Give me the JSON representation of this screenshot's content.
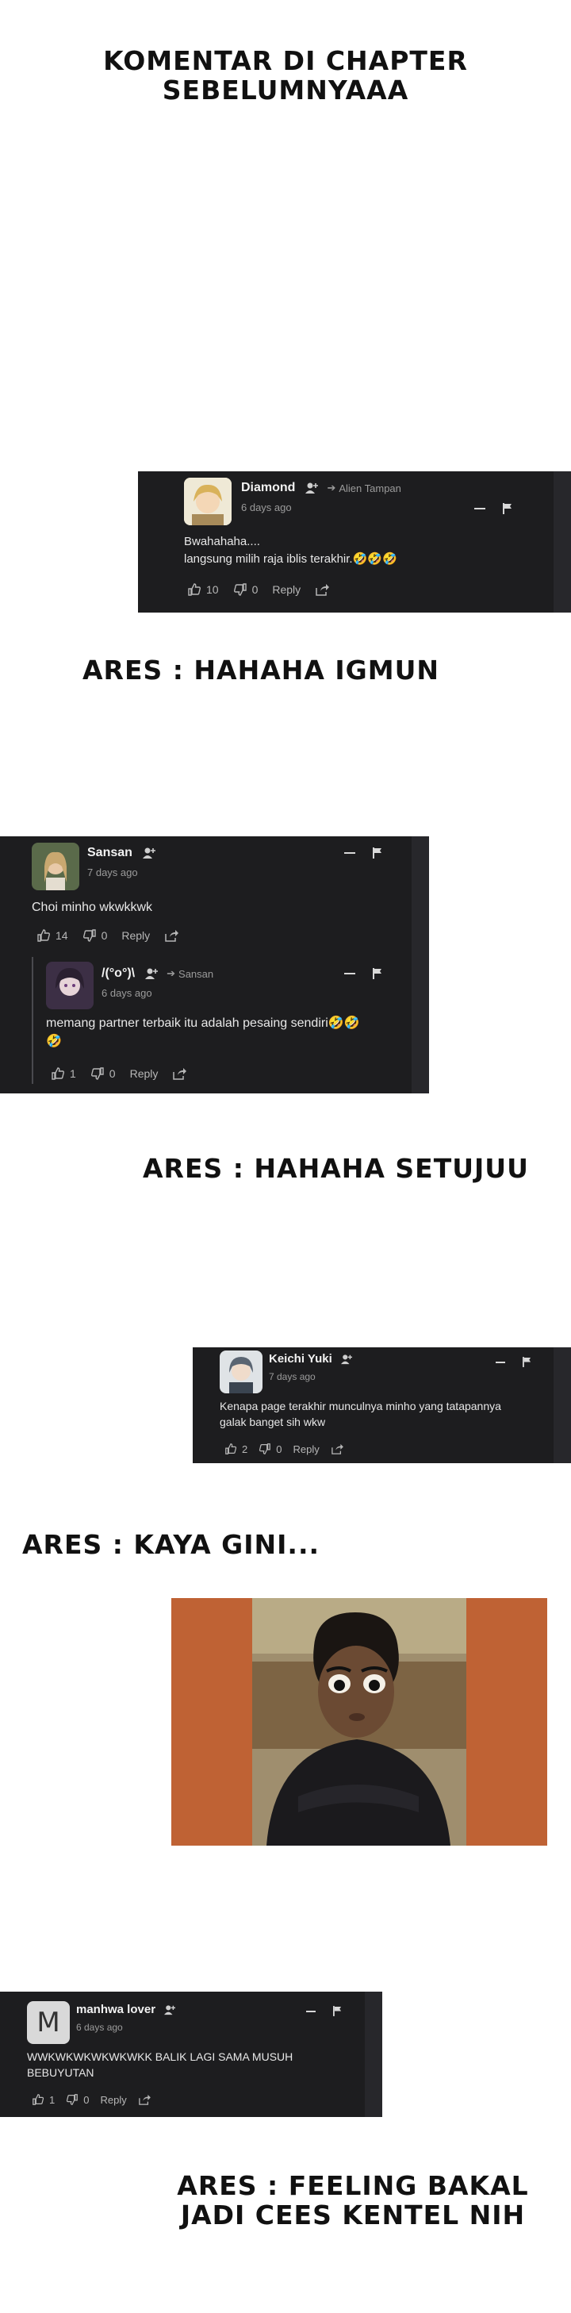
{
  "captions": {
    "intro_line1": "KOMENTAR DI CHAPTER",
    "intro_line2": "SEBELUMNYAAA",
    "ares1": "ARES : HAHAHA IGMUN",
    "ares2": "ARES : HAHAHA SETUJUU",
    "ares3": "ARES : KAYA GINI...",
    "ares4_line1": "ARES : FEELING BAKAL",
    "ares4_line2": "JADI CEES KENTEL NIH"
  },
  "comments": {
    "diamond": {
      "username": "Diamond",
      "reply_to": "Alien Tampan",
      "time": "6 days ago",
      "line1": "Bwahahaha....",
      "line2": "langsung milih raja iblis terakhir.",
      "emoji": "🤣🤣🤣",
      "likes": "10",
      "dislikes": "0",
      "reply_label": "Reply"
    },
    "sansan": {
      "username": "Sansan",
      "time": "7 days ago",
      "text": "Choi minho wkwkkwk",
      "likes": "14",
      "dislikes": "0",
      "reply_label": "Reply"
    },
    "reply_sansan": {
      "username": "/(°o°)\\",
      "reply_to": "Sansan",
      "time": "6 days ago",
      "line1": "memang partner terbaik itu adalah pesaing sendiri",
      "emoji1": "🤣🤣",
      "emoji2": "🤣",
      "likes": "1",
      "dislikes": "0",
      "reply_label": "Reply"
    },
    "keichi": {
      "username": "Keichi Yuki",
      "time": "7 days ago",
      "line1": "Kenapa page terakhir munculnya minho yang tatapannya",
      "line2": "galak banget sih wkw",
      "likes": "2",
      "dislikes": "0",
      "reply_label": "Reply"
    },
    "manhwa": {
      "username": "manhwa lover",
      "avatar_letter": "M",
      "time": "6 days ago",
      "line1": "WWKWKWKWKWKWKK BALIK LAGI SAMA MUSUH",
      "line2": "BEBUYUTAN",
      "likes": "1",
      "dislikes": "0",
      "reply_label": "Reply"
    }
  },
  "colors": {
    "card_bg": "#1d1d1f",
    "meme_bg": "#bf6234"
  }
}
